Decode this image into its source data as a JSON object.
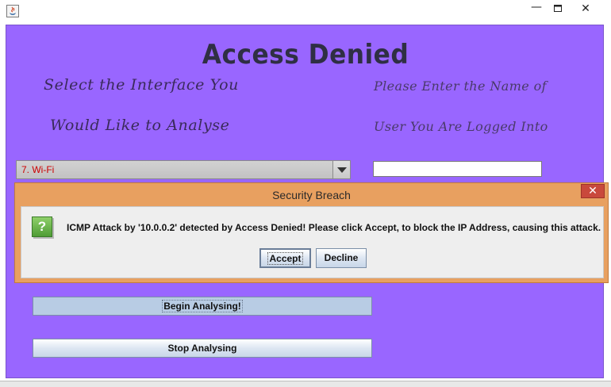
{
  "window": {
    "icon": "java-app-icon",
    "controls": {
      "minimize": "—",
      "maximize": "maximize-icon",
      "close": "✕"
    }
  },
  "app": {
    "title": "Access Denied",
    "interface_label_line1": "Select the Interface You",
    "interface_label_line2": "Would Like to Analyse",
    "user_label_line1": "Please Enter the Name of",
    "user_label_line2": "User You Are Logged Into",
    "interface_select": {
      "value": "7. Wi-Fi"
    },
    "user_field": {
      "value": ""
    },
    "begin_button": "Begin Analysing!",
    "stop_button": "Stop Analysing"
  },
  "dialog": {
    "title": "Security Breach",
    "close_glyph": "✕",
    "icon_glyph": "?",
    "message": "ICMP Attack by '10.0.0.2' detected by Access Denied! Please click Accept, to block the IP Address, causing this attack.",
    "accept_label": "Accept",
    "decline_label": "Decline"
  },
  "colors": {
    "background": "#9966ff",
    "dialog_title_bar": "#e8a060",
    "dialog_close": "#c9493c",
    "combo_text": "#cc0000"
  }
}
